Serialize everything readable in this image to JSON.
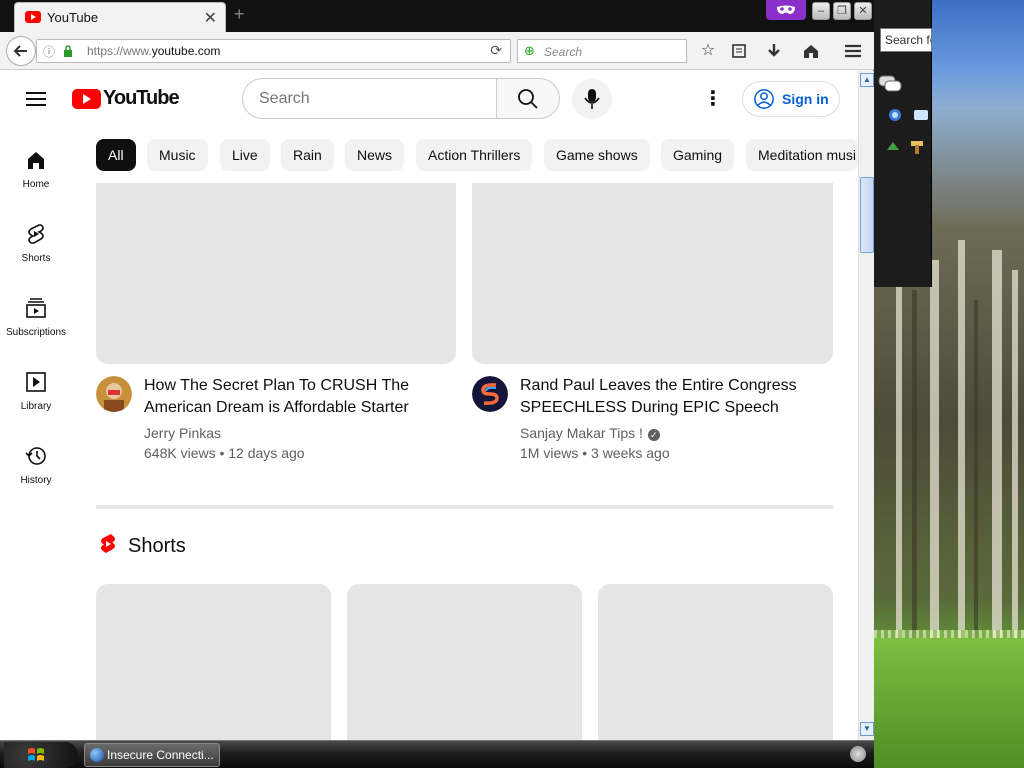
{
  "browser": {
    "tab": {
      "title": "YouTube",
      "close": "✕"
    },
    "new_tab": "+",
    "url": {
      "prefix": "https://www.",
      "host": "youtube.com"
    },
    "searchbar_placeholder": "Search",
    "window_controls": {
      "minimize": "–",
      "restore": "❐",
      "close": "✕"
    }
  },
  "youtube": {
    "logo_text": "YouTube",
    "search_placeholder": "Search",
    "sign_in": "Sign in",
    "chips": [
      "All",
      "Music",
      "Live",
      "Rain",
      "News",
      "Action Thrillers",
      "Game shows",
      "Gaming",
      "Meditation musi"
    ],
    "active_chip": "All",
    "guide": [
      {
        "label": "Home",
        "icon": "home-icon"
      },
      {
        "label": "Shorts",
        "icon": "shorts-icon"
      },
      {
        "label": "Subscriptions",
        "icon": "subscriptions-icon"
      },
      {
        "label": "Library",
        "icon": "library-icon"
      },
      {
        "label": "History",
        "icon": "history-icon"
      }
    ],
    "videos": [
      {
        "title_line1": "How The Secret Plan To CRUSH The",
        "title_line2": "American Dream is Affordable Starter",
        "channel": "Jerry Pinkas",
        "meta": "648K views • 12 days ago",
        "verified": false
      },
      {
        "title_line1": "Rand Paul Leaves the Entire Congress",
        "title_line2": "SPEECHLESS During EPIC Speech",
        "channel": "Sanjay Makar Tips !",
        "meta": "1M views • 3 weeks ago",
        "verified": true
      }
    ],
    "shorts_heading": "Shorts"
  },
  "side_panel": {
    "search_text": "Search fo"
  },
  "taskbar": {
    "task_label": "Insecure Connecti..."
  },
  "colors": {
    "youtube_red": "#ff0000",
    "link_blue": "#065fd4",
    "private_purple": "#8b2fc9"
  }
}
